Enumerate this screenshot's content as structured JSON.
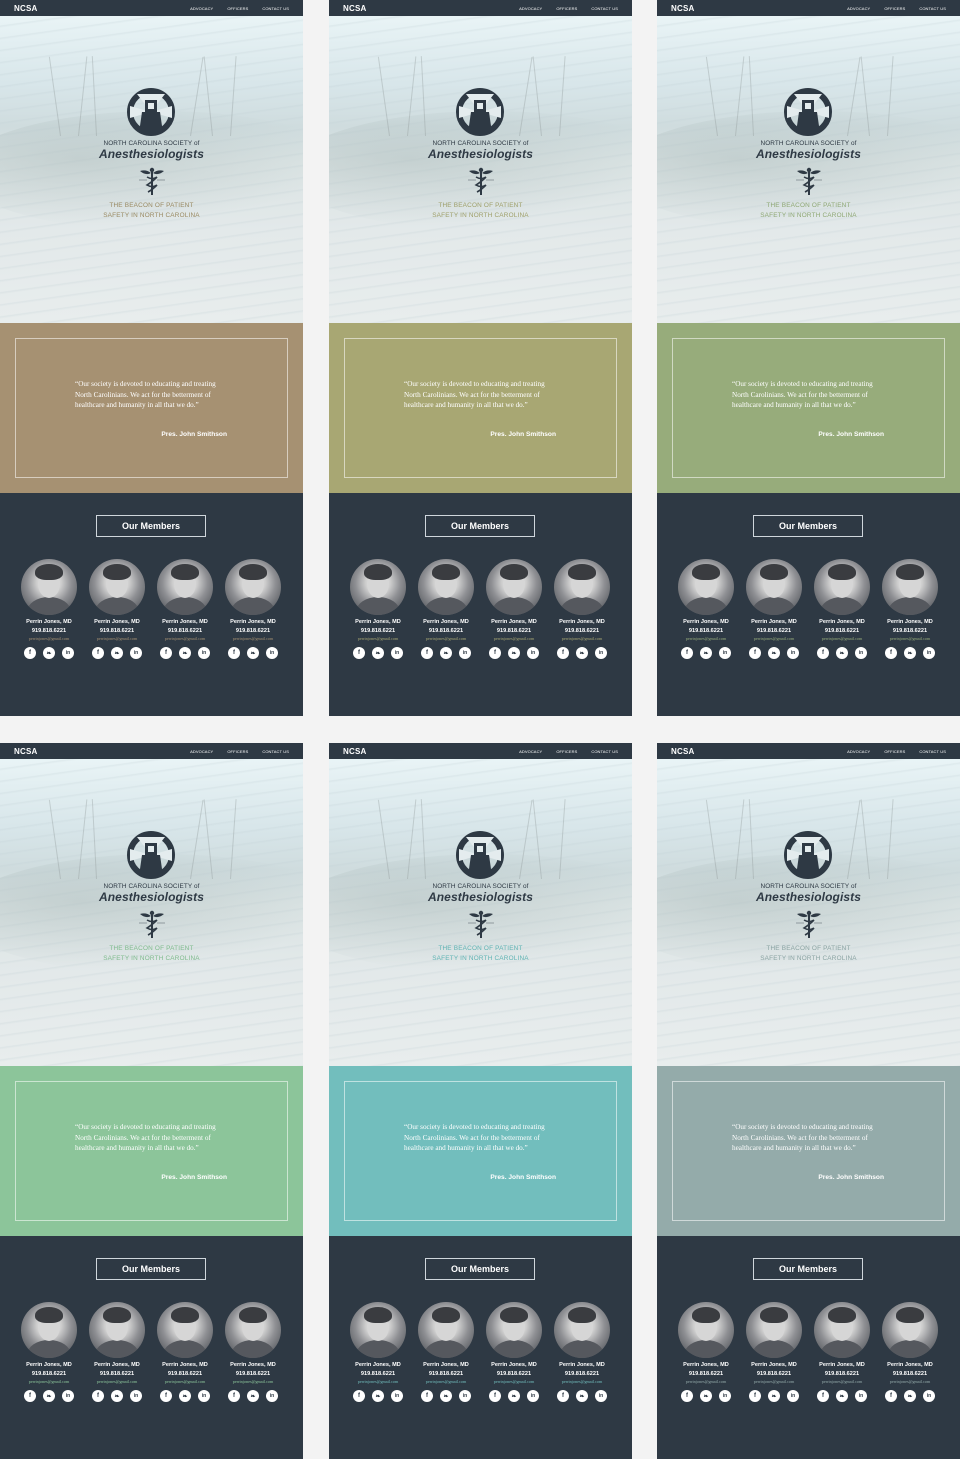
{
  "nav": {
    "brand": "NCSA",
    "links": [
      "ADVOCACY",
      "OFFICERS",
      "CONTACT US"
    ]
  },
  "hero": {
    "org_line1": "NORTH CAROLINA SOCIETY of",
    "org_line2": "Anesthesiologists",
    "tagline_line1": "THE BEACON OF PATIENT",
    "tagline_line2": "SAFETY IN NORTH CAROLINA"
  },
  "quote": {
    "text": "“Our society is devoted to educating and treating North Carolinians. We act for the betterment of healthcare and humanity in all that we do.”",
    "author": "Pres. John Smithson"
  },
  "members": {
    "heading": "Our Members",
    "list": [
      {
        "name": "Perrin Jones, MD",
        "phone": "919.818.6221",
        "email": "perrinjones@gmail.com"
      },
      {
        "name": "Perrin Jones, MD",
        "phone": "919.818.6221",
        "email": "perrinjones@gmail.com"
      },
      {
        "name": "Perrin Jones, MD",
        "phone": "919.818.6221",
        "email": "perrinjones@gmail.com"
      },
      {
        "name": "Perrin Jones, MD",
        "phone": "919.818.6221",
        "email": "perrinjones@gmail.com"
      }
    ],
    "social_icons": [
      "facebook-icon",
      "twitter-icon",
      "linkedin-icon"
    ]
  },
  "variants": [
    {
      "accent": "#a69172",
      "tagline_color": "#9a8a62"
    },
    {
      "accent": "#a8a773",
      "tagline_color": "#9fa06a"
    },
    {
      "accent": "#97ac7b",
      "tagline_color": "#8fa874"
    },
    {
      "accent": "#8cc59a",
      "tagline_color": "#7fbb8d"
    },
    {
      "accent": "#72bebd",
      "tagline_color": "#5fb3b3"
    },
    {
      "accent": "#94abaa",
      "tagline_color": "#8aa3a2"
    }
  ]
}
